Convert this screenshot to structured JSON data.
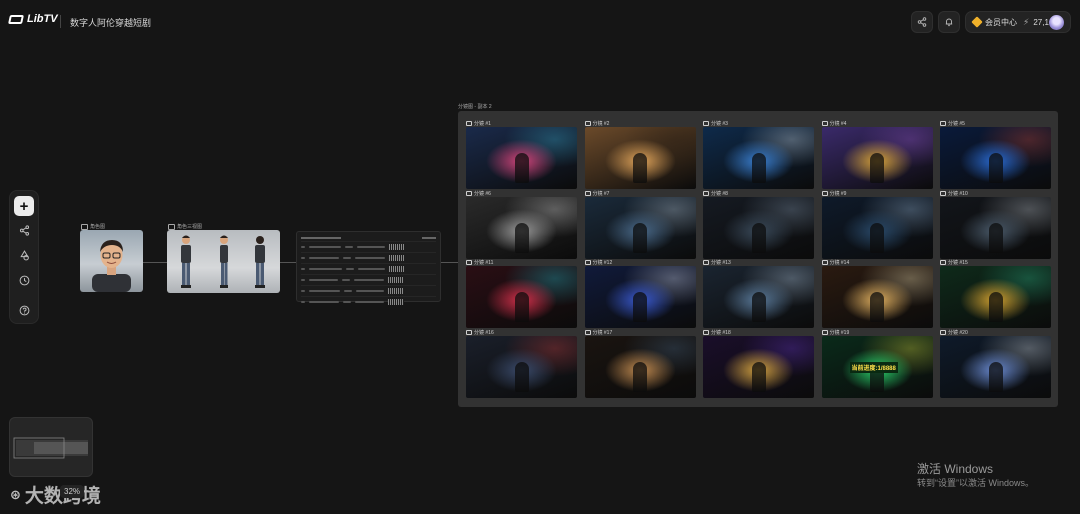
{
  "header": {
    "logo_text": "LibTV",
    "project_title": "数字人阿伦穿越短剧",
    "member_label": "会员中心",
    "credits": "27,168"
  },
  "toolbar": {
    "items": [
      {
        "name": "add",
        "icon": "plus-icon"
      },
      {
        "name": "workflow",
        "icon": "share-nodes-icon"
      },
      {
        "name": "assets",
        "icon": "shapes-icon"
      },
      {
        "name": "history",
        "icon": "clock-icon"
      },
      {
        "name": "help",
        "icon": "help-icon"
      }
    ]
  },
  "nodes": {
    "character_image_label": "角色图",
    "character_turnaround_label": "角色三视图"
  },
  "storyboard": {
    "title": "分镜图 - 副本 2",
    "shots": [
      {
        "label": "分镜 #1"
      },
      {
        "label": "分镜 #2"
      },
      {
        "label": "分镜 #3"
      },
      {
        "label": "分镜 #4"
      },
      {
        "label": "分镜 #5"
      },
      {
        "label": "分镜 #6"
      },
      {
        "label": "分镜 #7"
      },
      {
        "label": "分镜 #8"
      },
      {
        "label": "分镜 #9"
      },
      {
        "label": "分镜 #10"
      },
      {
        "label": "分镜 #11"
      },
      {
        "label": "分镜 #12"
      },
      {
        "label": "分镜 #13"
      },
      {
        "label": "分镜 #14"
      },
      {
        "label": "分镜 #15"
      },
      {
        "label": "分镜 #16"
      },
      {
        "label": "分镜 #17"
      },
      {
        "label": "分镜 #18"
      },
      {
        "label": "分镜 #19"
      },
      {
        "label": "分镜 #20"
      }
    ],
    "shot19_overlay": "当前进度:1/8888"
  },
  "watermark": {
    "line1": "激活 Windows",
    "line2": "转到“设置”以激活 Windows。"
  },
  "brand_overlay": "大数跨境",
  "zoom_level": "32%"
}
